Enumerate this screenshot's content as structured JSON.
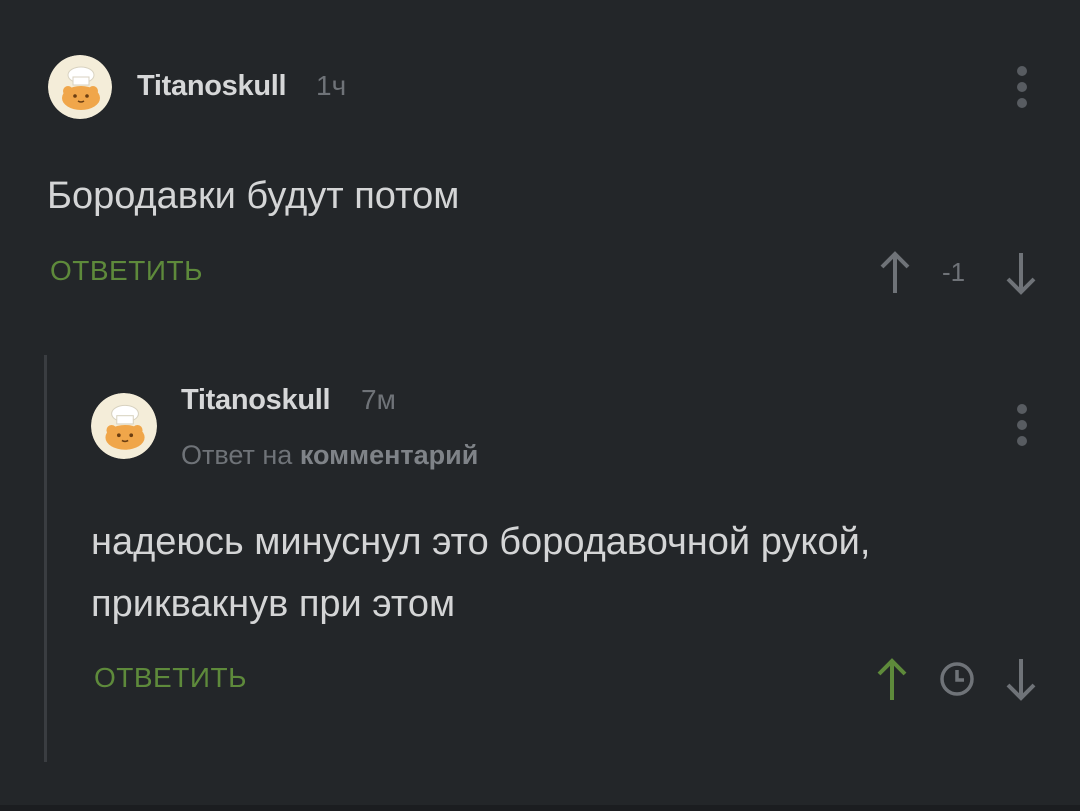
{
  "comments": [
    {
      "username": "Titanoskull",
      "time": "1ч",
      "text": "Бородавки будут потом",
      "reply_label": "ОТВЕТИТЬ",
      "score": "-1",
      "icons": {
        "avatar": "chef-cat-avatar",
        "more": "more-vertical-icon",
        "upvote": "arrow-up-icon",
        "downvote": "arrow-down-icon"
      }
    },
    {
      "username": "Titanoskull",
      "time": "7м",
      "reply_to_prefix": "Ответ на",
      "reply_to_link": "комментарий",
      "text_lines": [
        "надеюсь минуснул это бородавочной рукой,",
        "приквакнув при этом"
      ],
      "reply_label": "ОТВЕТИТЬ",
      "icons": {
        "avatar": "chef-cat-avatar",
        "more": "more-vertical-icon",
        "upvote": "arrow-up-icon",
        "score": "clock-icon",
        "downvote": "arrow-down-icon"
      },
      "upvote_active": true
    }
  ],
  "colors": {
    "background": "#232629",
    "accent_green": "#5e8a3b",
    "muted_text": "#6f7378"
  }
}
